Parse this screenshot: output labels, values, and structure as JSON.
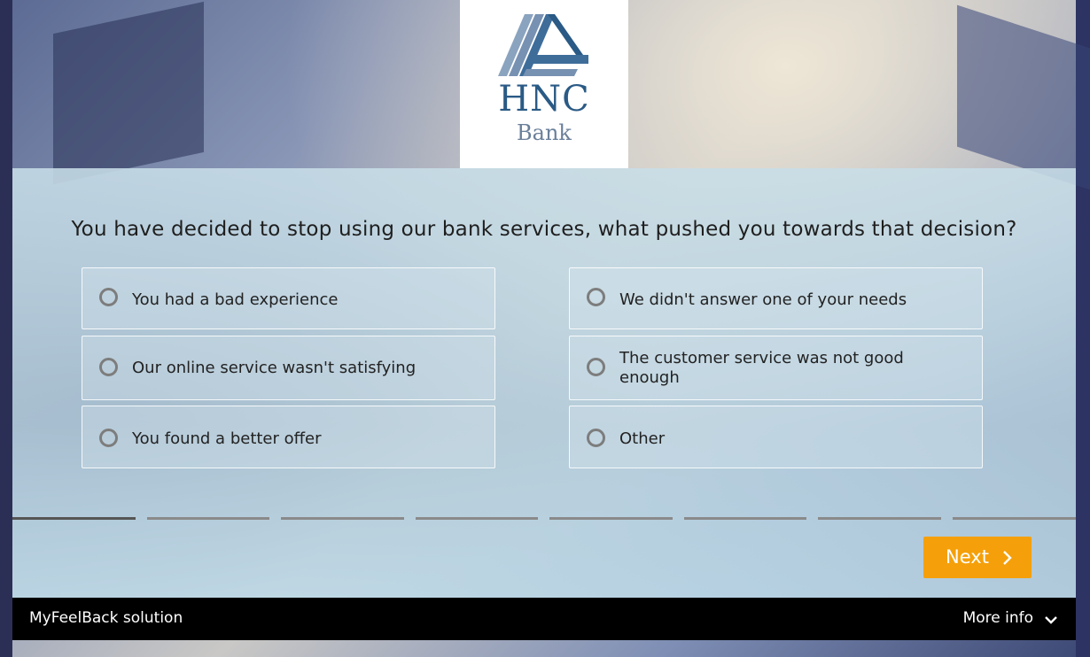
{
  "brand": {
    "name": "HNC",
    "sub": "Bank",
    "logo_icon": "triangle-stripes-logo",
    "primary_color": "#2a5a85"
  },
  "survey": {
    "question": "You have decided to stop using our bank services, what pushed you towards that decision?",
    "options": [
      {
        "label": "You had a bad experience",
        "selected": false
      },
      {
        "label": "We didn't answer one of your needs",
        "selected": false
      },
      {
        "label": "Our online service wasn't satisfying",
        "selected": false
      },
      {
        "label": "The customer service was not good enough",
        "selected": false
      },
      {
        "label": "You found a better offer",
        "selected": false
      },
      {
        "label": "Other",
        "selected": false
      }
    ],
    "progress": {
      "steps": 8,
      "current": 1
    },
    "next_label": "Next",
    "accent_color": "#f5a00a"
  },
  "footer": {
    "left": "MyFeelBack solution",
    "right": "More info",
    "right_icon": "chevron-down-icon"
  }
}
